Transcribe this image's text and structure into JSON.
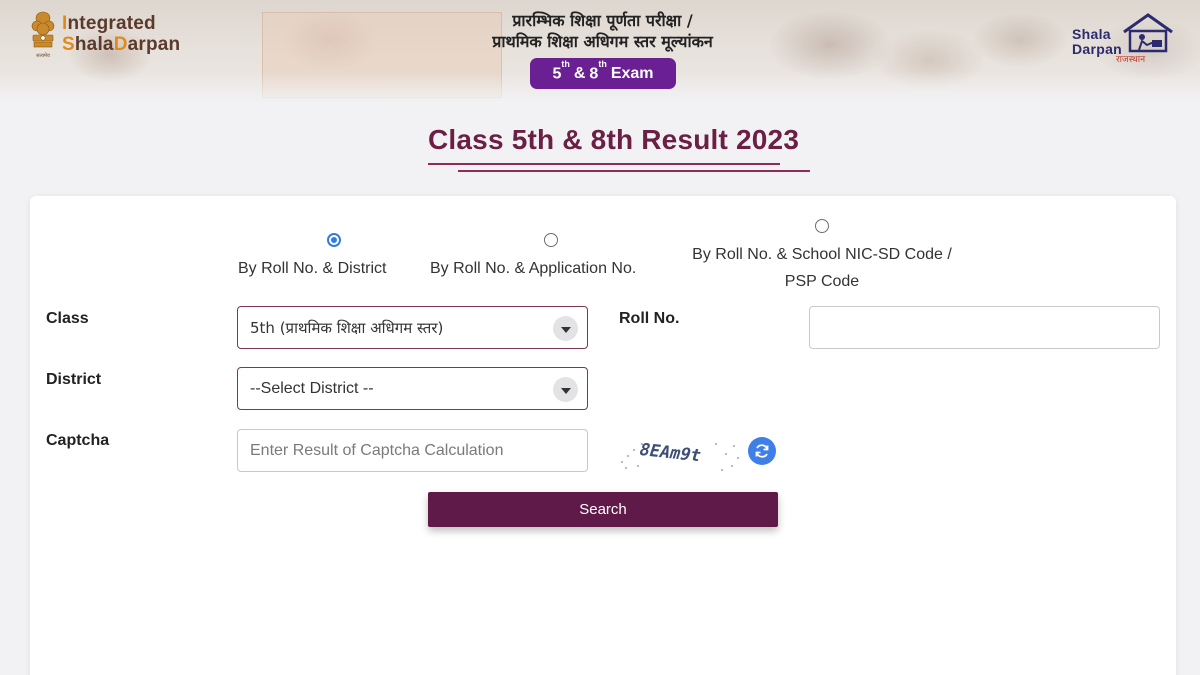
{
  "header": {
    "brand_line1": "Integrated",
    "brand_line2": "ShalaDarpan",
    "title_line1": "प्रारम्भिक शिक्षा पूर्णता परीक्षा /",
    "title_line2": "प्राथमिक शिक्षा अधिगम स्तर मूल्यांकन",
    "exam_badge": {
      "n1": "5",
      "sup1": "th",
      "amp": "&",
      "n2": "8",
      "sup2": "th",
      "word": "Exam"
    },
    "right_logo_line1": "Shala",
    "right_logo_line2": "Darpan",
    "right_logo_sub": "राजस्थान"
  },
  "page": {
    "title": "Class 5th & 8th Result 2023"
  },
  "search_mode": {
    "selected": "By Roll No. & District",
    "options": [
      {
        "label": "By Roll No. & District",
        "checked": true
      },
      {
        "label": "By Roll No. & Application No.",
        "checked": false
      },
      {
        "label_line1": "By Roll No. & School NIC-SD Code /",
        "label_line2": "PSP Code",
        "checked": false
      }
    ]
  },
  "form": {
    "class_label": "Class",
    "class_value": "5th (प्राथमिक शिक्षा अधिगम स्तर)",
    "roll_label": "Roll No.",
    "roll_value": "",
    "district_label": "District",
    "district_value": "--Select District --",
    "captcha_label": "Captcha",
    "captcha_placeholder": "Enter Result of Captcha Calculation",
    "captcha_text": "8EAm9t",
    "search_label": "Search"
  },
  "colors": {
    "accent": "#6b1f45",
    "button": "#5f1a4a",
    "badge": "#6a1f93",
    "radio": "#2f7de1",
    "refresh": "#3f7fe8"
  },
  "icons": {
    "emblem": "national-emblem-icon",
    "dropdown": "chevron-down-icon",
    "refresh": "refresh-icon",
    "school": "school-house-icon"
  }
}
